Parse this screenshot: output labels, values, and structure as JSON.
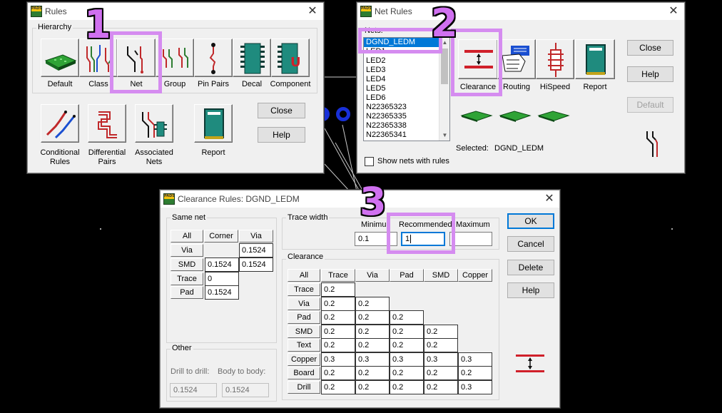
{
  "colors": {
    "highlight": "#d58cf0",
    "step_number": "#d070f0",
    "selection": "#0078d7",
    "canvas": "#000000"
  },
  "step_numbers": [
    "1",
    "2",
    "3"
  ],
  "rules_window": {
    "title": "Rules",
    "group_label": "Hierarchy",
    "items": [
      {
        "label": "Default",
        "icon": "board-icon"
      },
      {
        "label": "Class",
        "icon": "class-icon"
      },
      {
        "label": "Net",
        "icon": "net-icon"
      },
      {
        "label": "Group",
        "icon": "group-icon"
      },
      {
        "label": "Pin Pairs",
        "icon": "pin-pairs-icon"
      },
      {
        "label": "Decal",
        "icon": "decal-icon"
      },
      {
        "label": "Component",
        "icon": "component-icon"
      }
    ],
    "items2": [
      {
        "label_line1": "Conditional",
        "label_line2": "Rules",
        "icon": "conditional-rules-icon"
      },
      {
        "label_line1": "Differential",
        "label_line2": "Pairs",
        "icon": "differential-pairs-icon"
      },
      {
        "label_line1": "Associated",
        "label_line2": "Nets",
        "icon": "associated-nets-icon"
      },
      {
        "label_line1": "Report",
        "label_line2": "",
        "icon": "report-icon"
      }
    ],
    "close_label": "Close",
    "help_label": "Help"
  },
  "net_rules_window": {
    "title": "Net Rules",
    "nets_label": "Nets:",
    "nets": [
      "DGND_LEDM",
      "LED1",
      "LED2",
      "LED3",
      "LED4",
      "LED5",
      "LED6",
      "N22365323",
      "N22365335",
      "N22365338",
      "N22365341"
    ],
    "selected_index": 0,
    "show_nets_label": "Show nets with rules",
    "buttons": [
      {
        "label": "Clearance",
        "icon": "clearance-icon"
      },
      {
        "label": "Routing",
        "icon": "routing-icon"
      },
      {
        "label": "HiSpeed",
        "icon": "hispeed-icon"
      },
      {
        "label": "Report",
        "icon": "report-icon"
      }
    ],
    "close_label": "Close",
    "help_label": "Help",
    "default_label": "Default",
    "selected_label": "Selected:",
    "selected_value": "DGND_LEDM"
  },
  "clearance_window": {
    "title": "Clearance Rules:  DGND_LEDM",
    "same_net": {
      "label": "Same net",
      "headers": [
        "All",
        "Corner",
        "Via"
      ],
      "rows": [
        {
          "label": "Via",
          "values": [
            "",
            "0.1524"
          ]
        },
        {
          "label": "SMD",
          "values": [
            "0.1524",
            "0.1524"
          ]
        },
        {
          "label": "Trace",
          "values": [
            "0"
          ]
        },
        {
          "label": "Pad",
          "values": [
            "0.1524"
          ]
        }
      ]
    },
    "trace_width": {
      "label": "Trace width",
      "minimum_label": "Minimum",
      "recommended_label": "Recommended",
      "maximum_label": "Maximum",
      "minimum": "0.1",
      "recommended": "1",
      "maximum": ""
    },
    "clearance": {
      "label": "Clearance",
      "headers": [
        "All",
        "Trace",
        "Via",
        "Pad",
        "SMD",
        "Copper"
      ],
      "rows": [
        {
          "label": "Trace",
          "values": [
            "0.2"
          ]
        },
        {
          "label": "Via",
          "values": [
            "0.2",
            "0.2"
          ]
        },
        {
          "label": "Pad",
          "values": [
            "0.2",
            "0.2",
            "0.2"
          ]
        },
        {
          "label": "SMD",
          "values": [
            "0.2",
            "0.2",
            "0.2",
            "0.2"
          ]
        },
        {
          "label": "Text",
          "values": [
            "0.2",
            "0.2",
            "0.2",
            "0.2"
          ]
        },
        {
          "label": "Copper",
          "values": [
            "0.3",
            "0.3",
            "0.3",
            "0.3",
            "0.3"
          ]
        },
        {
          "label": "Board",
          "values": [
            "0.2",
            "0.2",
            "0.2",
            "0.2",
            "0.2"
          ]
        },
        {
          "label": "Drill",
          "values": [
            "0.2",
            "0.2",
            "0.2",
            "0.2",
            "0.3"
          ]
        }
      ]
    },
    "other": {
      "label": "Other",
      "drill_label": "Drill to drill:",
      "body_label": "Body to body:",
      "drill_value": "0.1524",
      "body_value": "0.1524"
    },
    "ok_label": "OK",
    "cancel_label": "Cancel",
    "delete_label": "Delete",
    "help_label": "Help"
  }
}
